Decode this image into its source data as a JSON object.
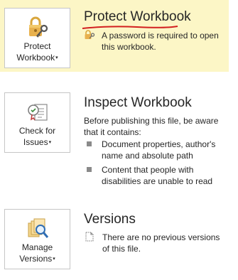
{
  "protect": {
    "tile_line1": "Protect",
    "tile_line2": "Workbook",
    "title": "Protect Workbook",
    "message_line1": "A password is required to open",
    "message_line2": "this workbook.",
    "highlight_color": "#fcf6c6",
    "icon": "lock-key-icon"
  },
  "inspect": {
    "tile_line1": "Check for",
    "tile_line2": "Issues",
    "title": "Inspect Workbook",
    "desc_line1": "Before publishing this file, be aware",
    "desc_line2": "that it contains:",
    "bullets": [
      {
        "line1": "Document properties, author's",
        "line2": "name and absolute path"
      },
      {
        "line1": "Content that people with",
        "line2": "disabilities are unable to read"
      }
    ],
    "icon": "inspect-checklist-icon"
  },
  "versions": {
    "tile_line1": "Manage",
    "tile_line2": "Versions",
    "title": "Versions",
    "message_line1": "There are no previous versions",
    "message_line2": "of this file.",
    "icon": "versions-magnifier-icon"
  },
  "caret_glyph": "▾"
}
